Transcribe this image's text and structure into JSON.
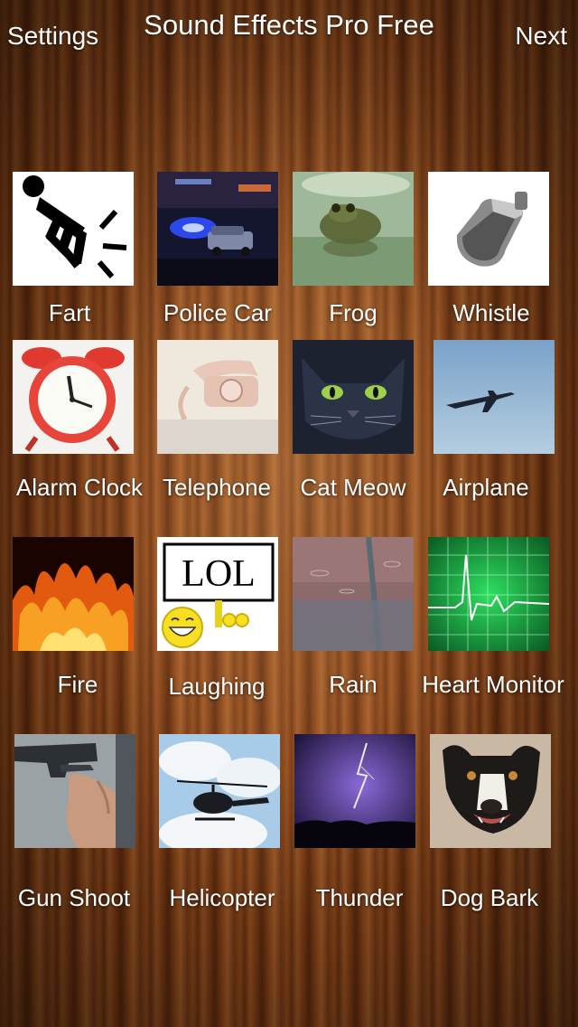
{
  "nav": {
    "title": "Sound Effects Pro Free",
    "left_label": "Settings",
    "right_label": "Next"
  },
  "sounds": [
    {
      "label": "Fart",
      "icon": "fart-icon"
    },
    {
      "label": "Police Car",
      "icon": "police-car-icon"
    },
    {
      "label": "Frog",
      "icon": "frog-icon"
    },
    {
      "label": "Whistle",
      "icon": "whistle-icon"
    },
    {
      "label": "Alarm Clock",
      "icon": "alarm-clock-icon"
    },
    {
      "label": "Telephone",
      "icon": "telephone-icon"
    },
    {
      "label": "Cat Meow",
      "icon": "cat-icon"
    },
    {
      "label": "Airplane",
      "icon": "airplane-icon"
    },
    {
      "label": "Fire",
      "icon": "fire-icon"
    },
    {
      "label": "Laughing",
      "icon": "laughing-icon",
      "sign_text": "LOL"
    },
    {
      "label": "Rain",
      "icon": "rain-icon"
    },
    {
      "label": "Heart Monitor",
      "icon": "heart-monitor-icon"
    },
    {
      "label": "Gun Shoot",
      "icon": "gun-icon"
    },
    {
      "label": "Helicopter",
      "icon": "helicopter-icon"
    },
    {
      "label": "Thunder",
      "icon": "thunder-icon"
    },
    {
      "label": "Dog Bark",
      "icon": "dog-icon"
    }
  ]
}
